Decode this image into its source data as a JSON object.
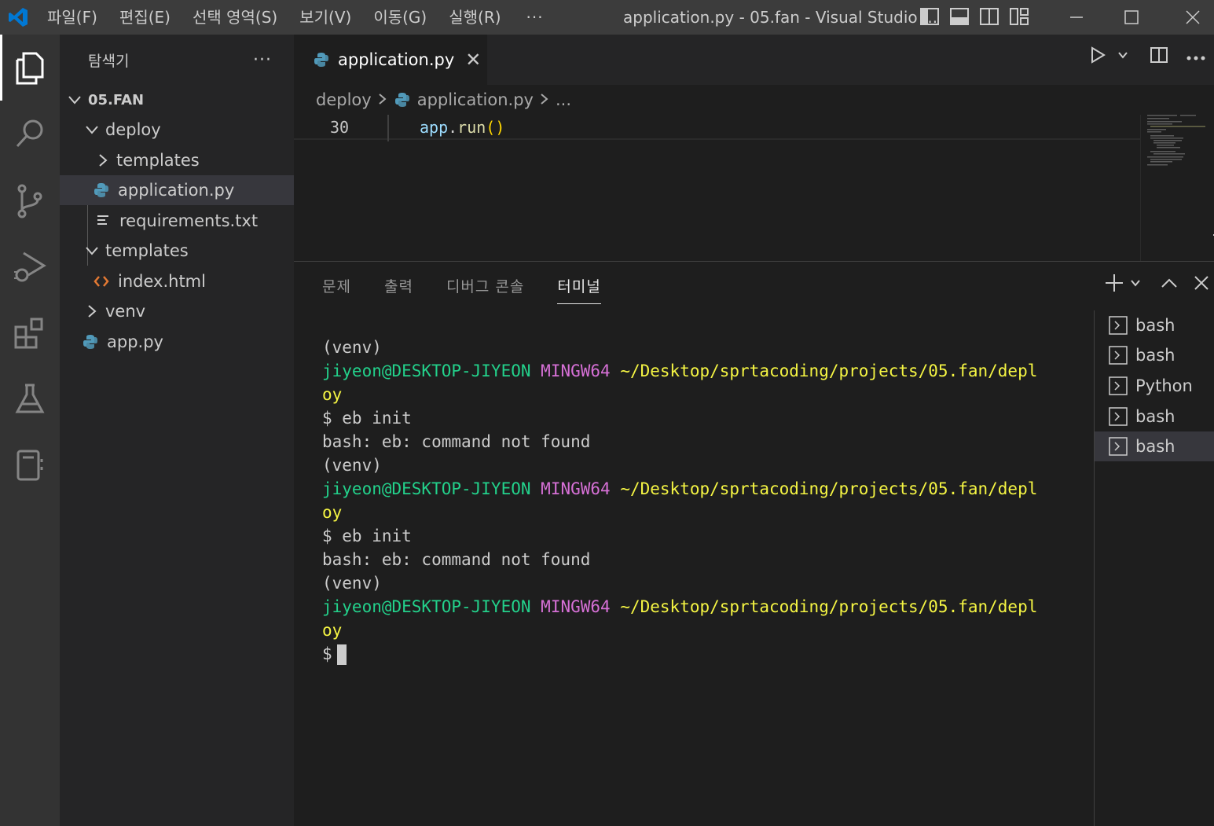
{
  "titlebar": {
    "menu": [
      "파일(F)",
      "편집(E)",
      "선택 영역(S)",
      "보기(V)",
      "이동(G)",
      "실행(R)"
    ],
    "more": "···",
    "title": "application.py - 05.fan - Visual Studio ..."
  },
  "sidebar": {
    "title": "탐색기",
    "more": "···",
    "root": "05.FAN",
    "items": [
      {
        "label": "deploy"
      },
      {
        "label": "templates"
      },
      {
        "label": "application.py"
      },
      {
        "label": "requirements.txt"
      },
      {
        "label": "templates"
      },
      {
        "label": "index.html"
      },
      {
        "label": "venv"
      },
      {
        "label": "app.py"
      }
    ]
  },
  "editor": {
    "tab_label": "application.py",
    "tab_close": "✕",
    "breadcrumb": [
      "deploy",
      "application.py",
      "..."
    ],
    "line_number": "30",
    "code": {
      "obj": "app",
      "dot": ".",
      "fn": "run",
      "parens": "()"
    }
  },
  "panel": {
    "tabs": [
      "문제",
      "출력",
      "디버그 콘솔",
      "터미널"
    ],
    "terminal": {
      "venv": "(venv)",
      "user": "jiyeon@DESKTOP-JIYEON",
      "env": "MINGW64",
      "path_a": "~/Desktop/sprtacoding/projects/05.fan/depl",
      "path_b": "oy",
      "cmd": "$ eb init",
      "error": "bash: eb: command not found",
      "prompt": "$"
    },
    "terminals": [
      "bash",
      "bash",
      "Python",
      "bash",
      "bash"
    ]
  },
  "colors": {
    "accent": "#0078d4",
    "python_icon": "#519aba",
    "html_icon": "#e37933",
    "term_green": "#23d18b",
    "term_magenta": "#d670d6",
    "term_yellow": "#f5f543"
  }
}
